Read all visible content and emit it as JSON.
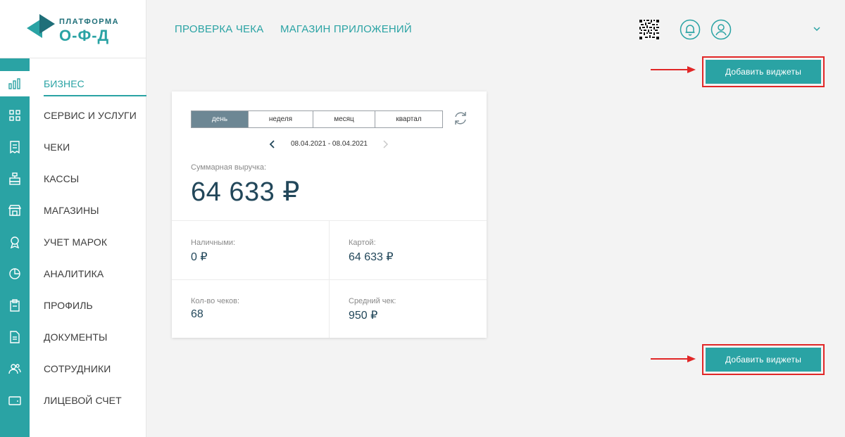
{
  "brand": {
    "top": "ПЛАТФОРМА",
    "bottom": "О-Ф-Д",
    "colors": {
      "teal": "#2aa3a4",
      "dark_teal": "#1f6f79"
    }
  },
  "topnav": {
    "links": [
      "ПРОВЕРКА ЧЕКА",
      "МАГАЗИН ПРИЛОЖЕНИЙ"
    ],
    "icons": [
      "qr-code-icon",
      "bell-icon",
      "user-icon",
      "chevron-down-icon"
    ]
  },
  "sidebar": {
    "items": [
      {
        "label": "БИЗНЕС",
        "icon": "bar-chart-icon",
        "active": true
      },
      {
        "label": "СЕРВИС И УСЛУГИ",
        "icon": "grid-icon"
      },
      {
        "label": "ЧЕКИ",
        "icon": "receipt-icon"
      },
      {
        "label": "КАССЫ",
        "icon": "cash-register-icon"
      },
      {
        "label": "МАГАЗИНЫ",
        "icon": "store-icon"
      },
      {
        "label": "УЧЕТ МАРОК",
        "icon": "award-icon"
      },
      {
        "label": "АНАЛИТИКА",
        "icon": "pie-chart-icon"
      },
      {
        "label": "ПРОФИЛЬ",
        "icon": "clipboard-icon"
      },
      {
        "label": "ДОКУМЕНТЫ",
        "icon": "document-icon"
      },
      {
        "label": "СОТРУДНИКИ",
        "icon": "users-icon"
      },
      {
        "label": "ЛИЦЕВОЙ СЧЕТ",
        "icon": "wallet-icon"
      }
    ]
  },
  "actions": {
    "add_widgets_top": "Добавить виджеты",
    "add_widgets_bottom": "Добавить виджеты"
  },
  "widget": {
    "tabs": [
      {
        "label": "день",
        "active": true
      },
      {
        "label": "неделя"
      },
      {
        "label": "месяц"
      },
      {
        "label": "квартал"
      }
    ],
    "date_range": "08.04.2021 - 08.04.2021",
    "total_label": "Суммарная выручка:",
    "total_value": "64 633 ₽",
    "stats": {
      "cash_label": "Наличными:",
      "cash_value": "0 ₽",
      "card_label": "Картой:",
      "card_value": "64 633 ₽",
      "receipts_label": "Кол-во чеков:",
      "receipts_value": "68",
      "avg_label": "Средний чек:",
      "avg_value": "950 ₽"
    }
  }
}
